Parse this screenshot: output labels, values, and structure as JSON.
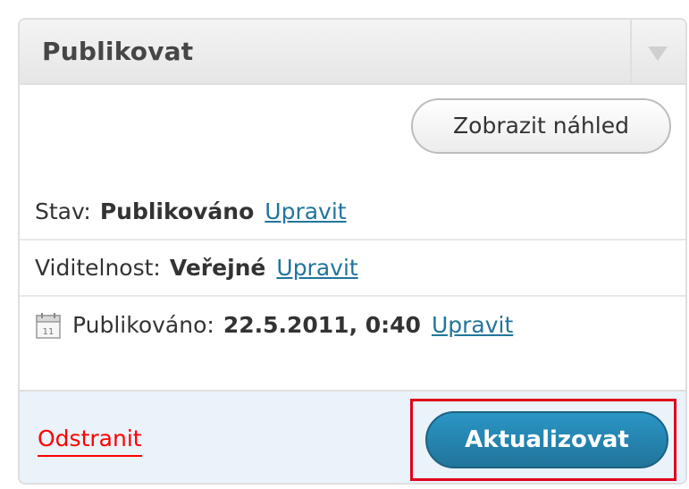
{
  "panel": {
    "title": "Publikovat",
    "toggle_icon": "triangle-down-icon"
  },
  "preview_button": {
    "label": "Zobrazit náhled"
  },
  "status": {
    "label": "Stav:",
    "value": "Publikováno",
    "edit_link": "Upravit"
  },
  "visibility": {
    "label": "Viditelnost:",
    "value": "Veřejné",
    "edit_link": "Upravit"
  },
  "published": {
    "icon": "calendar-icon",
    "calendar_day": "11",
    "label": "Publikováno:",
    "value": "22.5.2011, 0:40",
    "edit_link": "Upravit"
  },
  "footer": {
    "delete_link": "Odstranit",
    "update_button": "Aktualizovat",
    "highlight_color": "#e0001b",
    "delete_color": "#ff0000",
    "button_color": "#21759b"
  }
}
